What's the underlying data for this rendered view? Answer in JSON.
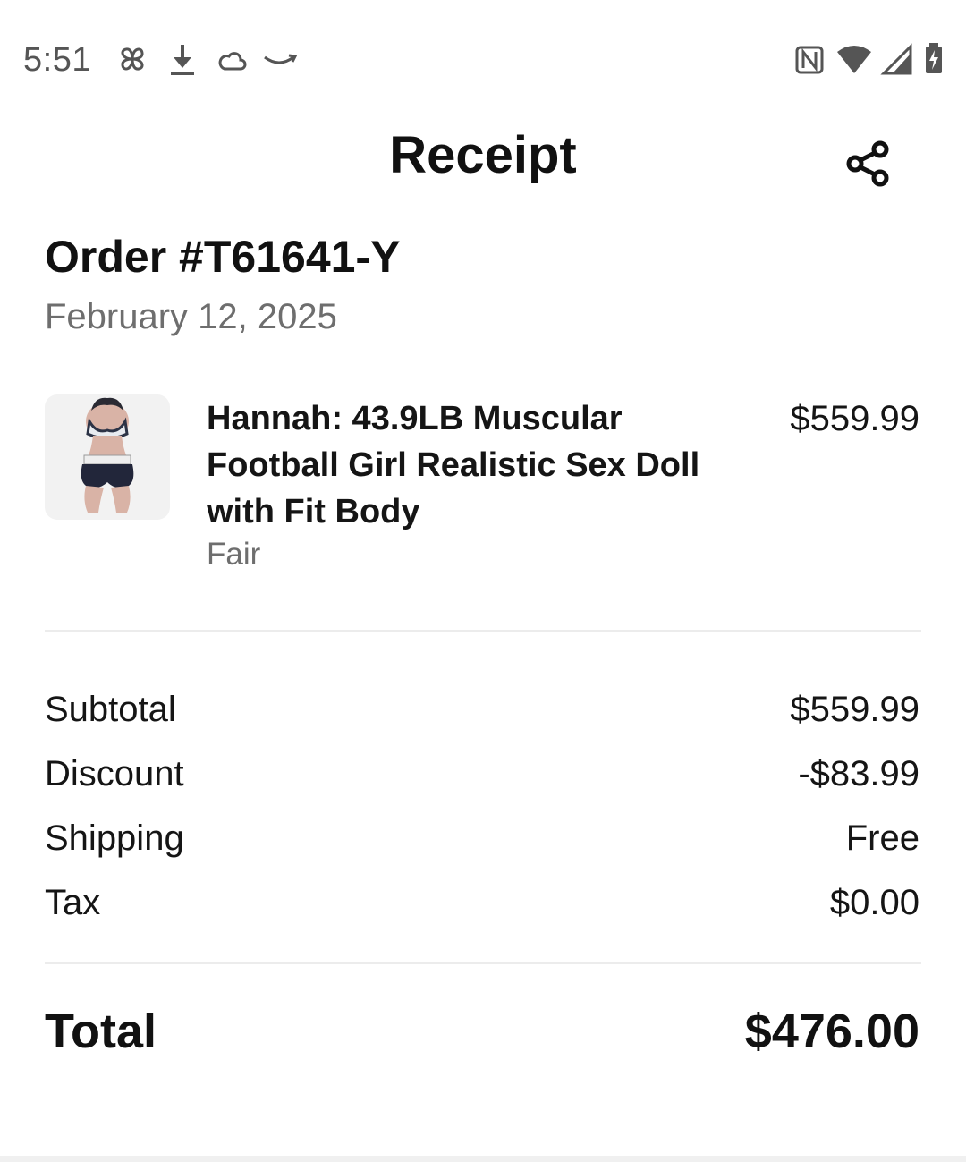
{
  "status_bar": {
    "time": "5:51",
    "left_icons": [
      "pinwheel-icon",
      "download-icon",
      "cloud-icon",
      "amazon-smile-icon"
    ],
    "right_icons": [
      "nfc-icon",
      "wifi-icon",
      "cell-signal-icon",
      "battery-charging-icon"
    ]
  },
  "header": {
    "title": "Receipt",
    "share_icon": "share-icon"
  },
  "order": {
    "number": "Order #T61641-Y",
    "date": "February 12, 2025"
  },
  "item": {
    "title": "Hannah: 43.9LB Muscular Football Girl Realistic Sex Doll with Fit Body",
    "condition": "Fair",
    "price": "$559.99"
  },
  "summary": {
    "subtotal_label": "Subtotal",
    "subtotal_value": "$559.99",
    "discount_label": "Discount",
    "discount_value": "-$83.99",
    "shipping_label": "Shipping",
    "shipping_value": "Free",
    "tax_label": "Tax",
    "tax_value": "$0.00"
  },
  "total": {
    "label": "Total",
    "value": "$476.00"
  },
  "colors": {
    "text_primary": "#111111",
    "text_secondary": "#6e6e6e",
    "divider": "#ececec",
    "background": "#ffffff"
  }
}
